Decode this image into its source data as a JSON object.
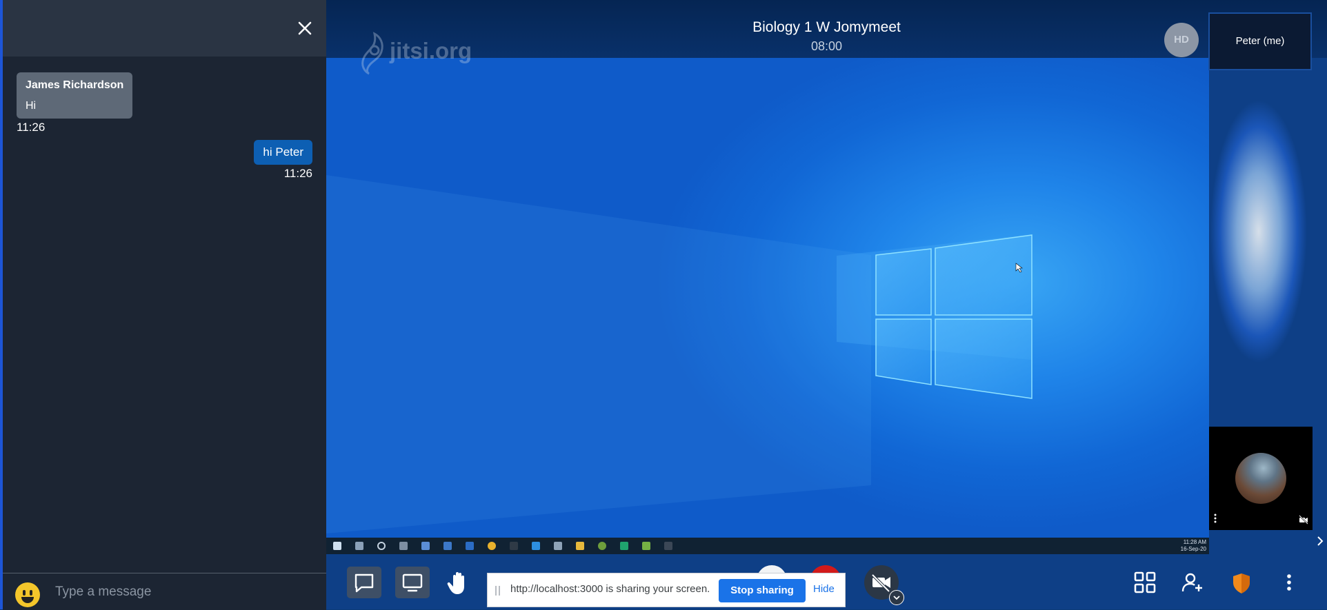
{
  "meeting": {
    "title": "Biology 1 W Jomymeet",
    "timer": "08:00",
    "quality_badge": "HD",
    "watermark": "jitsi.org"
  },
  "chat": {
    "messages": [
      {
        "sender": "James Richardson",
        "text": "Hi",
        "time": "11:26",
        "direction": "incoming"
      },
      {
        "text": "hi Peter",
        "time": "11:26",
        "direction": "outgoing"
      }
    ],
    "input_placeholder": "Type a message"
  },
  "participants": {
    "self_label": "Peter (me)"
  },
  "shared_desktop": {
    "clock_time": "11:28 AM",
    "clock_date": "16-Sep-20"
  },
  "share_banner": {
    "message": "http://localhost:3000 is sharing your screen.",
    "stop_label": "Stop sharing",
    "hide_label": "Hide"
  },
  "colors": {
    "chat_panel_bg": "#1c2533",
    "outgoing_bubble": "#0d5fb3",
    "incoming_bubble": "#5e6977",
    "stop_button": "#1a73e8",
    "hangup": "#d21a1a",
    "security_shield": "#f18a1c"
  },
  "icons": [
    "close-icon",
    "emoji-icon",
    "chat-icon",
    "screen-share-icon",
    "raise-hand-icon",
    "camera-off-icon",
    "chevron-down-icon",
    "tile-view-icon",
    "invite-icon",
    "security-shield-icon",
    "more-icon",
    "chevron-right-icon",
    "mic-muted-icon"
  ]
}
